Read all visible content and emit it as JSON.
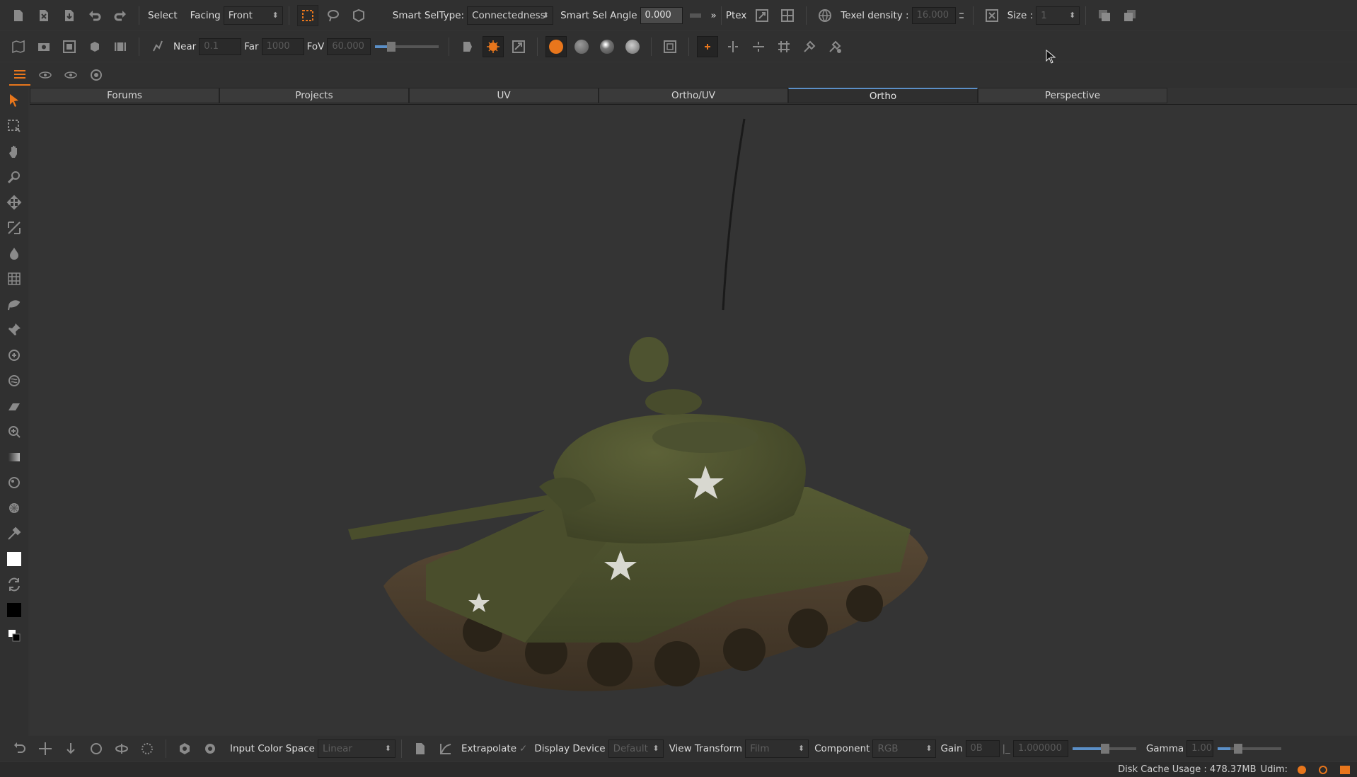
{
  "toolbar1": {
    "select_label": "Select",
    "facing_label": "Facing",
    "facing_value": "Front",
    "smart_seltype_label": "Smart SelType:",
    "smart_seltype_value": "Connectedness",
    "smart_sel_angle_label": "Smart Sel Angle",
    "smart_sel_angle_value": "0.000",
    "more_glyph": "»",
    "ptex_label": "Ptex",
    "texel_density_label": "Texel density :",
    "texel_density_value": "16.000",
    "size_label": "Size :",
    "size_value": "1"
  },
  "toolbar2": {
    "near_label": "Near",
    "near_value": "0.1",
    "far_label": "Far",
    "far_value": "1000",
    "fov_label": "FoV",
    "fov_value": "60.000"
  },
  "tabs": [
    {
      "label": "Forums"
    },
    {
      "label": "Projects"
    },
    {
      "label": "UV"
    },
    {
      "label": "Ortho/UV"
    },
    {
      "label": "Ortho"
    },
    {
      "label": "Perspective"
    }
  ],
  "active_tab": "Ortho",
  "bottombar": {
    "input_color_space_label": "Input Color Space",
    "input_color_space_value": "Linear",
    "extrapolate_label": "Extrapolate",
    "display_device_label": "Display Device",
    "display_device_value": "Default",
    "view_transform_label": "View Transform",
    "view_transform_value": "Film",
    "component_label": "Component",
    "component_value": "RGB",
    "gain_label": "Gain",
    "gain_value": "0B",
    "gain_number": "1.000000",
    "gamma_label": "Gamma",
    "gamma_value": "1.00"
  },
  "status": {
    "disk_cache_label": "Disk Cache Usage : 478.37MB",
    "udim_label": "Udim:"
  },
  "colors": {
    "accent_orange": "#e8761c",
    "accent_blue": "#5b8fc7",
    "background": "#333333"
  },
  "icons": {
    "paint_brush": "paint-brush-icon",
    "tank_model": "tank-model"
  }
}
